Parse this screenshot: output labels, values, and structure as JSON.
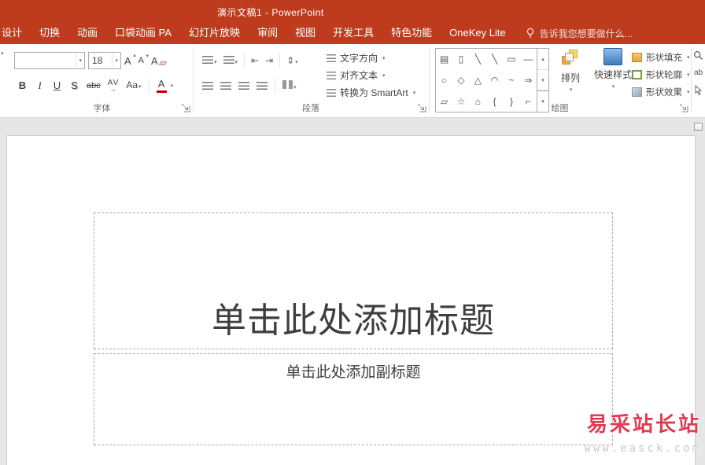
{
  "colors": {
    "titlebar": "#BE3B1E",
    "accent_red": "#E23A4F",
    "font_color_bar": "#C00000",
    "canvas_bg": "#E7E6E6"
  },
  "window": {
    "title": "演示文稿1 - PowerPoint"
  },
  "tabs": [
    "设计",
    "切换",
    "动画",
    "口袋动画 PA",
    "幻灯片放映",
    "审阅",
    "视图",
    "开发工具",
    "特色功能",
    "OneKey Lite"
  ],
  "tellme": {
    "label": "告诉我您想要做什么..."
  },
  "glyphs": {
    "dropdown": "▾",
    "up": "▴",
    "arrow_lr": "↔",
    "replace": "ab"
  },
  "ribbon": {
    "font": {
      "label": "字体",
      "font_name_value": "",
      "font_size_value": "18",
      "grow_font": "A",
      "shrink_font": "A",
      "clear_formatting": "A",
      "bold": "B",
      "italic": "I",
      "underline": "U",
      "shadow": "S",
      "strikethrough": "abc",
      "char_spacing": "AV",
      "change_case": "Aa",
      "font_color": "A"
    },
    "paragraph": {
      "label": "段落",
      "text_direction": "文字方向",
      "align_text": "对齐文本",
      "convert_smartart": "转换为 SmartArt"
    },
    "drawing": {
      "label": "绘图",
      "arrange": "排列",
      "quick_styles": "快速样式",
      "shape_fill": "形状填充",
      "shape_outline": "形状轮廓",
      "shape_effects": "形状效果",
      "shapes": [
        [
          "▤",
          "▯",
          "╲",
          "╲",
          "▭",
          "—"
        ],
        [
          "○",
          "◇",
          "△",
          "◠",
          "~",
          "⇒"
        ],
        [
          "▱",
          "☆",
          "⌂",
          "{",
          "}",
          "⌐"
        ]
      ]
    }
  },
  "slide": {
    "title_placeholder": "单击此处添加标题",
    "subtitle_placeholder": "单击此处添加副标题"
  },
  "watermark": {
    "site_name": "易采站长站",
    "site_url": "www.easck.com"
  }
}
